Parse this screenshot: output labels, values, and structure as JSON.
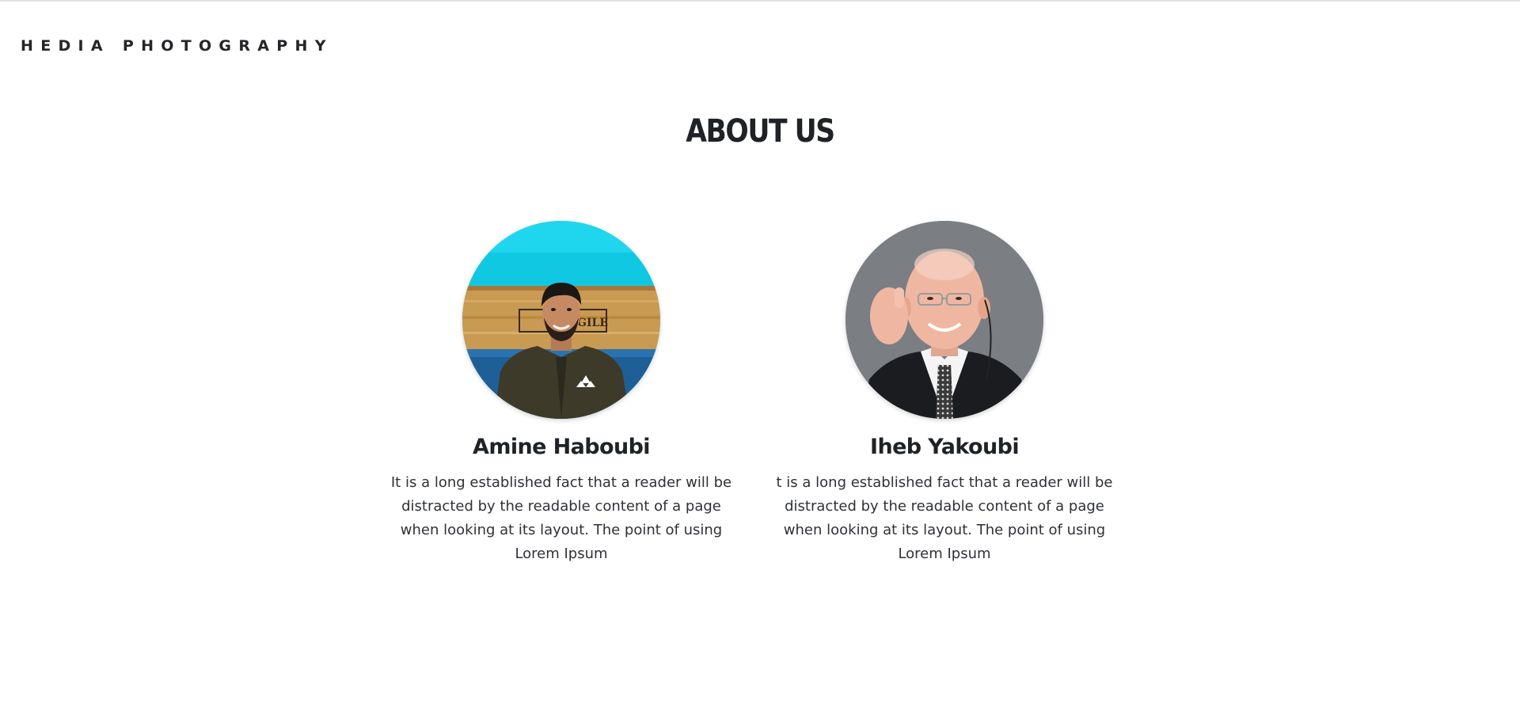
{
  "header": {
    "brand": "HEDIA PHOTOGRAPHY"
  },
  "main": {
    "title": "ABOUT US",
    "members": [
      {
        "name": "Amine Haboubi",
        "bio": "It is a long established fact that a reader will be distracted by the readable content of a page when looking at its layout. The point of using Lorem Ipsum",
        "photo_sign_text": "GILE"
      },
      {
        "name": "Iheb Yakoubi",
        "bio": "t is a long established fact that a reader will be distracted by the readable content of a page when looking at its layout. The point of using Lorem Ipsum"
      }
    ]
  },
  "colors": {
    "text": "#23252a",
    "background": "#ffffff",
    "accent_cyan": "#14cfe8"
  }
}
